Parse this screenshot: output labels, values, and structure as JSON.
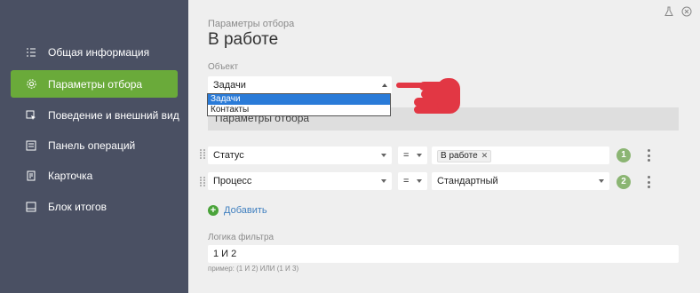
{
  "sidebar": {
    "items": [
      {
        "label": "Общая информация",
        "icon": "list-icon"
      },
      {
        "label": "Параметры отбора",
        "icon": "gear-icon",
        "active": true
      },
      {
        "label": "Поведение и внешний вид",
        "icon": "cursor-icon"
      },
      {
        "label": "Панель операций",
        "icon": "panel-icon"
      },
      {
        "label": "Карточка",
        "icon": "card-icon"
      },
      {
        "label": "Блок итогов",
        "icon": "summary-icon"
      }
    ]
  },
  "main": {
    "subtitle": "Параметры отбора",
    "title": "В работе",
    "object_label": "Объект",
    "object_value": "Задачи",
    "dropdown_options": [
      "Задачи",
      "Контакты"
    ],
    "section_title": "Параметры отбора",
    "rows": [
      {
        "field": "Статус",
        "op": "=",
        "value_tag": "В работе",
        "number": "1"
      },
      {
        "field": "Процесс",
        "op": "=",
        "value": "Стандартный",
        "number": "2"
      }
    ],
    "add_label": "Добавить",
    "logic_label": "Логика фильтра",
    "logic_value": "1 И 2",
    "logic_hint": "пример: (1 И 2) ИЛИ (1 И 3)"
  },
  "colors": {
    "sidebar_bg": "#4a5063",
    "active_item": "#6aaa3a",
    "badge": "#8bb573",
    "pointer_hand": "#e23744",
    "selected_option": "#2a7bd8"
  }
}
